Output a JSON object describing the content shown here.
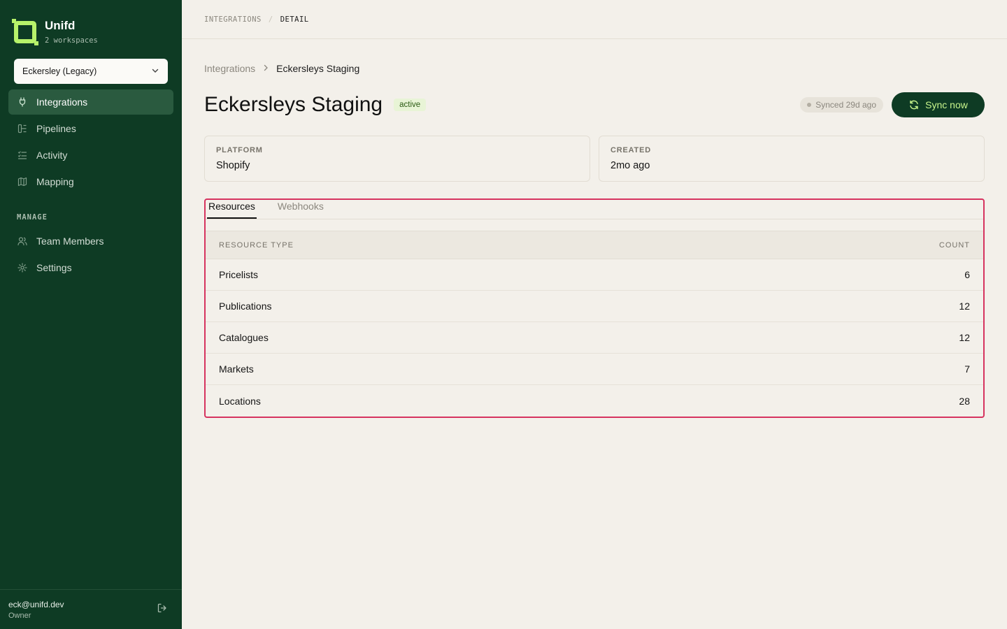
{
  "app": {
    "name": "Unifd",
    "workspaces_count": "2 workspaces"
  },
  "workspace": {
    "selected": "Eckersley (Legacy)"
  },
  "sidebar": {
    "items": [
      {
        "label": "Integrations",
        "icon": "plug-icon"
      },
      {
        "label": "Pipelines",
        "icon": "pipeline-icon"
      },
      {
        "label": "Activity",
        "icon": "list-check-icon"
      },
      {
        "label": "Mapping",
        "icon": "map-icon"
      }
    ],
    "manage_label": "MANAGE",
    "manage_items": [
      {
        "label": "Team Members",
        "icon": "users-icon"
      },
      {
        "label": "Settings",
        "icon": "gear-icon"
      }
    ]
  },
  "user": {
    "email": "eck@unifd.dev",
    "role": "Owner"
  },
  "topbar": {
    "crumb1": "INTEGRATIONS",
    "sep": "/",
    "crumb2": "DETAIL"
  },
  "breadcrumb": {
    "parent": "Integrations",
    "current": "Eckersleys Staging"
  },
  "header": {
    "title": "Eckersleys Staging",
    "status": "active",
    "synced": "Synced 29d ago",
    "sync_button": "Sync now"
  },
  "cards": [
    {
      "label": "PLATFORM",
      "value": "Shopify"
    },
    {
      "label": "CREATED",
      "value": "2mo ago"
    }
  ],
  "tabs": [
    {
      "label": "Resources",
      "active": true
    },
    {
      "label": "Webhooks",
      "active": false
    }
  ],
  "table": {
    "columns": [
      "RESOURCE TYPE",
      "COUNT"
    ],
    "rows": [
      {
        "type": "Pricelists",
        "count": "6"
      },
      {
        "type": "Publications",
        "count": "12"
      },
      {
        "type": "Catalogues",
        "count": "12"
      },
      {
        "type": "Markets",
        "count": "7"
      },
      {
        "type": "Locations",
        "count": "28"
      }
    ]
  },
  "colors": {
    "sidebar_bg": "#0e3b24",
    "accent": "#b7f26a",
    "highlight_border": "#d6335f",
    "page_bg": "#f3f0ea"
  }
}
